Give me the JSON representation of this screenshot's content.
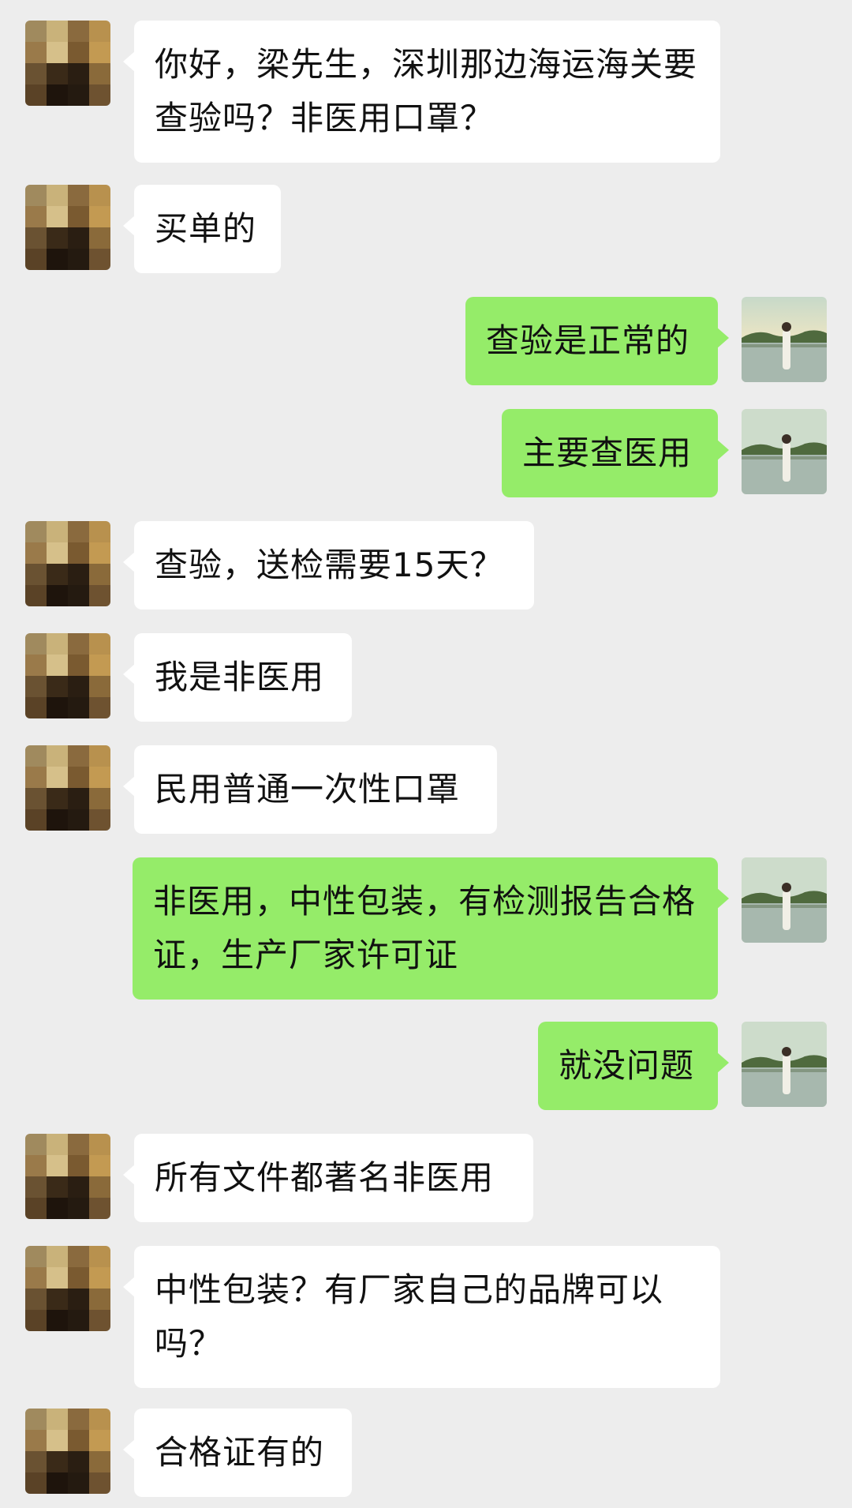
{
  "messages": [
    {
      "side": "left",
      "text": "你好，梁先生，深圳那边海运海关要查验吗？非医用口罩？"
    },
    {
      "side": "left",
      "text": "买单的"
    },
    {
      "side": "right",
      "text": "查验是正常的"
    },
    {
      "side": "right",
      "text": "主要查医用"
    },
    {
      "side": "left",
      "text": "查验，送检需要15天？"
    },
    {
      "side": "left",
      "text": "我是非医用"
    },
    {
      "side": "left",
      "text": "民用普通一次性口罩"
    },
    {
      "side": "right",
      "text": "非医用，中性包装，有检测报告合格证，生产厂家许可证"
    },
    {
      "side": "right",
      "text": "就没问题"
    },
    {
      "side": "left",
      "text": "所有文件都著名非医用"
    },
    {
      "side": "left",
      "text": "中性包装？有厂家自己的品牌可以吗？"
    },
    {
      "side": "left",
      "text": "合格证有的"
    }
  ],
  "avatars": {
    "contact": "pixelated-avatar-icon",
    "self": "landscape-photo-avatar-icon"
  },
  "colors": {
    "background": "#ededed",
    "incoming_bubble": "#ffffff",
    "outgoing_bubble": "#95ec69",
    "text": "#111111"
  }
}
